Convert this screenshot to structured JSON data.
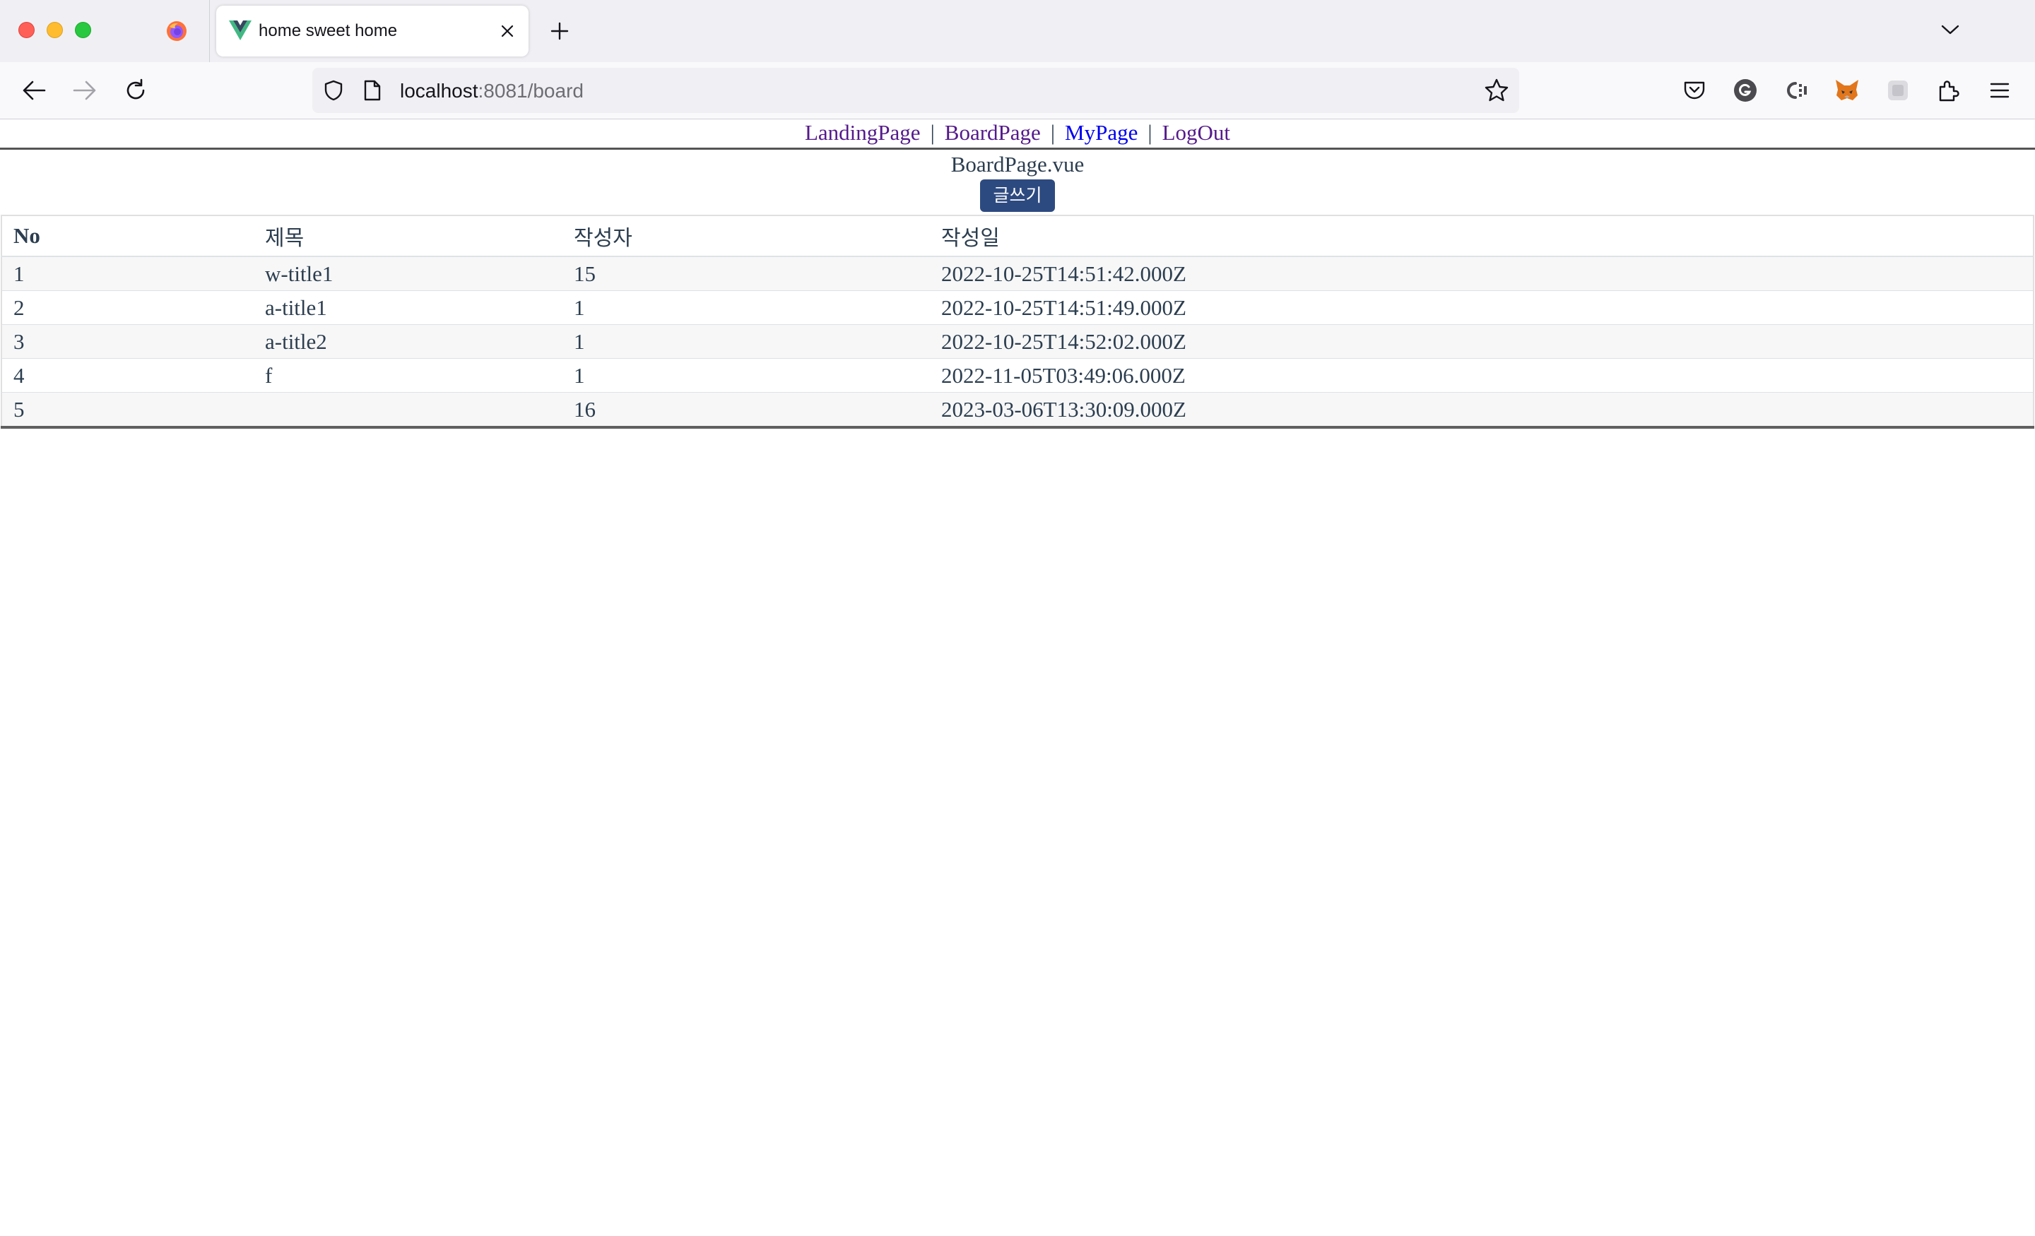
{
  "browser": {
    "tab_title": "home sweet home",
    "url_host": "localhost",
    "url_rest": ":8081/board"
  },
  "site_nav": {
    "items": [
      "LandingPage",
      "BoardPage",
      "MyPage",
      "LogOut"
    ],
    "separator": "|"
  },
  "page": {
    "heading": "BoardPage.vue",
    "write_button": "글쓰기"
  },
  "table": {
    "headers": [
      "No",
      "제목",
      "작성자",
      "작성일"
    ],
    "rows": [
      [
        "1",
        "w-title1",
        "15",
        "2022-10-25T14:51:42.000Z"
      ],
      [
        "2",
        "a-title1",
        "1",
        "2022-10-25T14:51:49.000Z"
      ],
      [
        "3",
        "a-title2",
        "1",
        "2022-10-25T14:52:02.000Z"
      ],
      [
        "4",
        "f",
        "1",
        "2022-11-05T03:49:06.000Z"
      ],
      [
        "5",
        "",
        "16",
        "2023-03-06T13:30:09.000Z"
      ]
    ]
  },
  "icons": {
    "back": "back-arrow-icon",
    "forward": "forward-arrow-icon",
    "reload": "reload-icon",
    "bookmark": "star-icon",
    "pocket": "pocket-icon",
    "grammarly": "grammarly-icon",
    "extensions": "puzzle-icon",
    "menu": "hamburger-menu-icon"
  }
}
